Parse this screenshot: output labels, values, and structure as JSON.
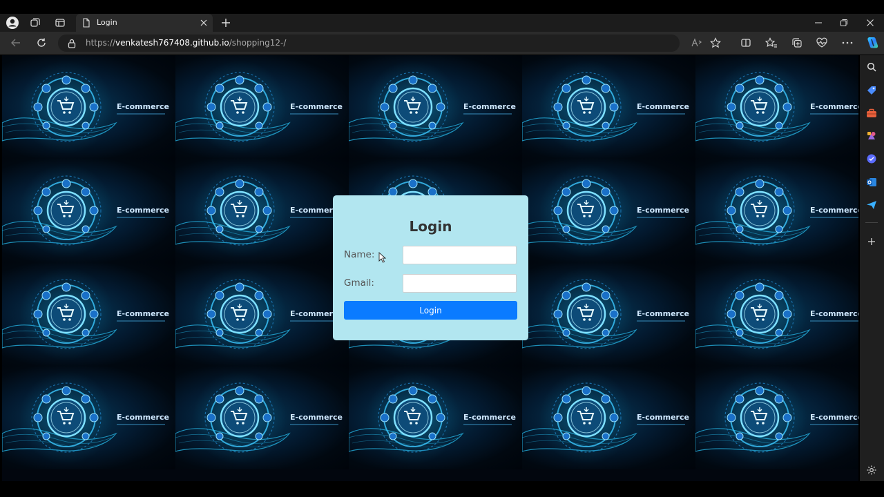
{
  "browser": {
    "tab": {
      "title": "Login"
    },
    "address": {
      "scheme": "https://",
      "host": "venkatesh767408.github.io",
      "path": "/shopping12-/"
    }
  },
  "background": {
    "tile_label": "E-commerce",
    "tile_rows": 4,
    "tile_cols": 5
  },
  "login": {
    "title": "Login",
    "name_label": "Name:",
    "name_value": "",
    "gmail_label": "Gmail:",
    "gmail_value": "",
    "button_label": "Login"
  },
  "colors": {
    "card_bg": "#b2e6f0",
    "button_bg": "#0a7bff",
    "glow": "#2ec7ff"
  },
  "icons": {
    "toolbar": [
      "back-icon",
      "refresh-icon",
      "lock-icon",
      "read-aloud-icon",
      "favorite-star-icon",
      "split-screen-icon",
      "favorites-icon",
      "collections-icon",
      "browser-essentials-icon",
      "more-icon",
      "copilot-icon"
    ],
    "sidebar": [
      "search-icon",
      "shopping-icon",
      "tools-icon",
      "games-icon",
      "copilot-sidebar-icon",
      "outlook-icon",
      "send-icon",
      "add-icon",
      "settings-icon"
    ]
  }
}
